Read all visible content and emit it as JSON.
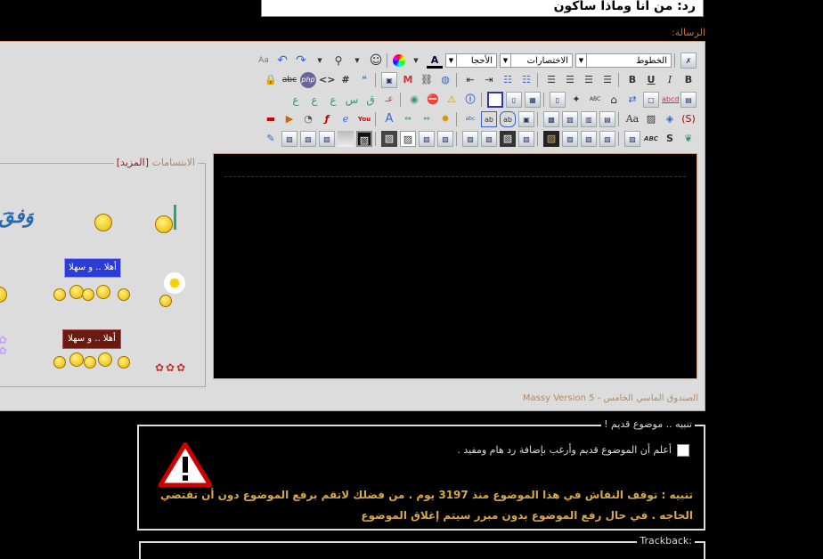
{
  "title_field": {
    "value": "رد: من أنا وماذا سأكون"
  },
  "message_label": "الرسالة:",
  "toolbar": {
    "font_select": "الخطوط",
    "shortcuts_select": "الاختصارات",
    "size_select": "الأحجا",
    "color_icon": "A",
    "bold": "B",
    "italic": "I",
    "underline": "U",
    "strike_label": "abc",
    "hash": "#",
    "code": "<>",
    "php": "php",
    "abc_icon": "abc",
    "youtube": "You",
    "font_aa": "Aa",
    "abc_caps": "ABC",
    "s_icon": "S"
  },
  "smilies": {
    "legend": "الابتسامات",
    "more": "[المزيد]",
    "sign1": "أهلا .. و سهلا",
    "sign2": "أهلا .. و سهلا",
    "calligraphy": "وَفقَ"
  },
  "version_text": "الصندوق الماسي الخامس - Massy Version 5",
  "warning": {
    "legend": "تنبيه .. موضوع قديم !",
    "checkbox_label": "أعلم أن الموضوع قديم وأرغب بإضافة رد هام ومفيد .",
    "text": "تنبيه : توقف النقاش في هذا الموضوع منذ 3197 يوم . من فضلك لاتقم برفع الموضوع دون أن تقتضي الحاجه . في حال رفع الموضوع بدون مبرر سيتم إغلاق الموضوع"
  },
  "trackback": {
    "legend": "Trackback:"
  },
  "colors": {
    "accent": "#d06a2f",
    "warning_text": "#d6a84a",
    "border": "#c8a27a"
  }
}
